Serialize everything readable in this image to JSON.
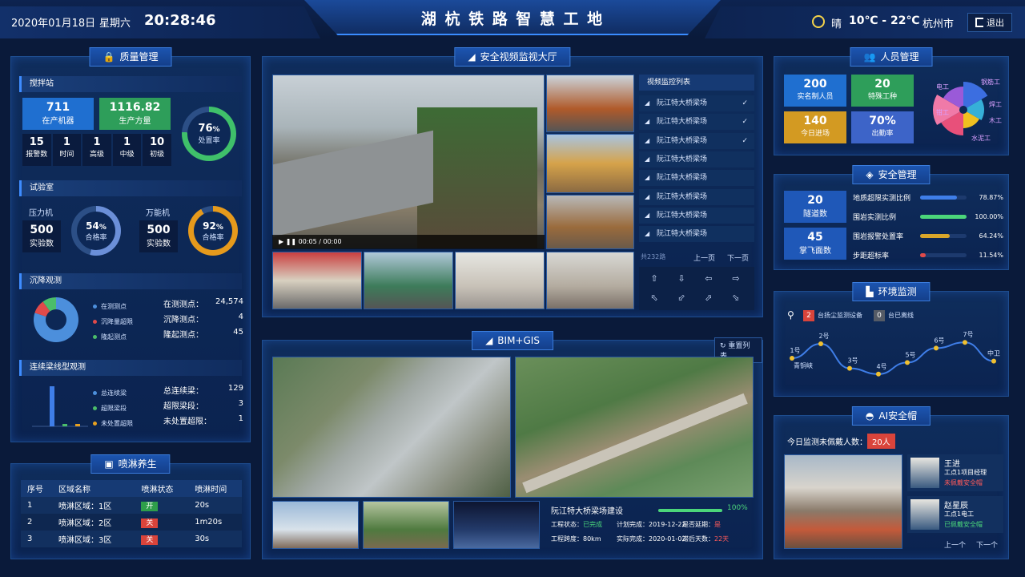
{
  "header": {
    "date": "2020年01月18日",
    "weekday": "星期六",
    "time": "20:28:46",
    "title": "湖 杭 铁 路 智 慧 工 地",
    "weather": "晴",
    "temperature": "10℃ - 22℃",
    "city": "杭州市",
    "logout": "退出"
  },
  "quality": {
    "title": "质量管理",
    "mixing": {
      "label": "搅拌站",
      "machines_value": "711",
      "machines_label": "在产机器",
      "volume_value": "1116.82",
      "volume_label": "生产方量",
      "ring_value": "76",
      "ring_unit": "%",
      "ring_label": "处置率",
      "ring_pct": 76,
      "stats": [
        {
          "v": "15",
          "l": "报警数"
        },
        {
          "v": "1",
          "l": "时间"
        },
        {
          "v": "1",
          "l": "高级"
        },
        {
          "v": "1",
          "l": "中级"
        },
        {
          "v": "10",
          "l": "初级"
        }
      ]
    },
    "lab": {
      "label": "试验室",
      "press_label": "压力机",
      "press_value": "500",
      "press_sub": "实验数",
      "press_ring": "54",
      "press_unit": "%",
      "press_ring_label": "合格率",
      "press_pct": 54,
      "univ_label": "万能机",
      "univ_value": "500",
      "univ_sub": "实验数",
      "univ_ring": "92",
      "univ_unit": "%",
      "univ_ring_label": "合格率",
      "univ_pct": 92
    },
    "settle": {
      "label": "沉降观测",
      "legend": [
        "在测测点",
        "沉降量超限",
        "隆起测点"
      ],
      "rows": [
        {
          "k": "在测测点：",
          "v": "24,574"
        },
        {
          "k": "沉降测点：",
          "v": "4"
        },
        {
          "k": "隆起测点：",
          "v": "45"
        }
      ],
      "pie": [
        {
          "pct": 0.8,
          "color": "#4c8fdc"
        },
        {
          "pct": 0.1,
          "color": "#e04a4a"
        },
        {
          "pct": 0.1,
          "color": "#4bbd6a"
        }
      ]
    },
    "beam": {
      "label": "连续梁线型观测",
      "legend": [
        "总连续梁",
        "超限梁段",
        "未处置超限"
      ],
      "rows": [
        {
          "k": "总连续梁：",
          "v": "129"
        },
        {
          "k": "超限梁段：",
          "v": "3"
        },
        {
          "k": "未处置超限：",
          "v": "1"
        }
      ],
      "bars": [
        129,
        3,
        1
      ]
    }
  },
  "spray": {
    "title": "喷淋养生",
    "headers": [
      "序号",
      "区域名称",
      "喷淋状态",
      "喷淋时间"
    ],
    "rows": [
      {
        "no": "1",
        "area": "喷淋区域：1区",
        "state": "开",
        "time": "20s",
        "color": "#2e9e4a"
      },
      {
        "no": "2",
        "area": "喷淋区域：2区",
        "state": "关",
        "time": "1m20s",
        "color": "#d9443b"
      },
      {
        "no": "3",
        "area": "喷淋区域：3区",
        "state": "关",
        "time": "30s",
        "color": "#d9443b"
      }
    ]
  },
  "video": {
    "title": "安全视频监视大厅",
    "time": "00:05 / 00:00",
    "list_title": "视频监控列表",
    "items": [
      "阮江特大桥梁场",
      "阮江特大桥梁场",
      "阮江特大桥梁场",
      "阮江特大桥梁场",
      "阮江特大桥梁场",
      "阮江特大桥梁场",
      "阮江特大桥梁场",
      "阮江特大桥梁场"
    ],
    "checked": [
      true,
      true,
      true,
      false,
      false,
      false,
      false,
      false
    ],
    "total": "共232路",
    "prev": "上一页",
    "next": "下一页"
  },
  "bim": {
    "title": "BIM+GIS",
    "reset": "重置列表",
    "project": "阮江特大桥梁场建设",
    "progress_label": "100%",
    "progress": 1.0,
    "fields": [
      {
        "k": "工程状态：",
        "v": "已完成",
        "c": "#4bd67a"
      },
      {
        "k": "计划完成：",
        "v": "2019-12-22",
        "c": "#fff"
      },
      {
        "k": "是否延期：",
        "v": "是",
        "c": "#ff5a5a"
      },
      {
        "k": "工程跨度：",
        "v": "80km",
        "c": "#fff"
      },
      {
        "k": "实际完成：",
        "v": "2020-01-02",
        "c": "#fff"
      },
      {
        "k": "滞后天数：",
        "v": "22天",
        "c": "#ff5a5a"
      }
    ]
  },
  "personnel": {
    "title": "人员管理",
    "cards": [
      {
        "v": "200",
        "l": "实名制人员",
        "c": "#1f6fd0"
      },
      {
        "v": "20",
        "l": "特殊工种",
        "c": "#2e9e5a"
      },
      {
        "v": "140",
        "l": "今日进场",
        "c": "#d39a22"
      },
      {
        "v": "70%",
        "l": "出勤率",
        "c": "#3d64c8"
      }
    ],
    "rose": [
      {
        "name": "电工",
        "v": 0.9,
        "c": "#3c6ee0"
      },
      {
        "name": "钢筋工",
        "v": 0.6,
        "c": "#36b0d8"
      },
      {
        "name": "焊工",
        "v": 0.5,
        "c": "#f0c020"
      },
      {
        "name": "木工",
        "v": 0.8,
        "c": "#e8507a"
      },
      {
        "name": "水泥工",
        "v": 1.0,
        "c": "#f07aa8"
      },
      {
        "name": "钳工",
        "v": 0.7,
        "c": "#9a5ad8"
      }
    ]
  },
  "safety": {
    "title": "安全管理",
    "cards": [
      {
        "v": "20",
        "l": "隧道数"
      },
      {
        "v": "45",
        "l": "掌飞面数"
      }
    ],
    "bars": [
      {
        "k": "地质超限实测比例",
        "v": "78.87%",
        "p": 0.7887,
        "c": "#3f7ee8"
      },
      {
        "k": "围岩实测比例",
        "v": "100.00%",
        "p": 1.0,
        "c": "#4bd67a"
      },
      {
        "k": "围岩报警处置率",
        "v": "64.24%",
        "p": 0.6424,
        "c": "#d9a62a"
      },
      {
        "k": "步距超标率",
        "v": "11.54%",
        "p": 0.1154,
        "c": "#e04a4a"
      }
    ]
  },
  "env": {
    "title": "环境监测",
    "device_count": "2",
    "device_label": "台扬尘监测设备",
    "offline_count": "0",
    "offline_label": "台已离线",
    "nodes": [
      {
        "n": "1号",
        "v": 1.5
      },
      {
        "n": "2号",
        "v": 2.5
      },
      {
        "n": "3号",
        "v": 0.8
      },
      {
        "n": "4号",
        "v": 0.4
      },
      {
        "n": "5号",
        "v": 1.2
      },
      {
        "n": "6号",
        "v": 2.2
      },
      {
        "n": "7号",
        "v": 2.6
      },
      {
        "n": "中卫",
        "v": 1.3
      }
    ],
    "start": "青铜峡"
  },
  "ai": {
    "title": "AI安全帽",
    "today_label": "今日监测未佩戴人数：",
    "today_count": "20人",
    "people": [
      {
        "name": "王进",
        "role": "工点1项目经理",
        "status": "未佩戴安全帽",
        "c": "#ff5a5a"
      },
      {
        "name": "赵星辰",
        "role": "工点1电工",
        "status": "已佩戴安全帽",
        "c": "#4bd67a"
      }
    ],
    "prev": "上一个",
    "next": "下一个"
  }
}
